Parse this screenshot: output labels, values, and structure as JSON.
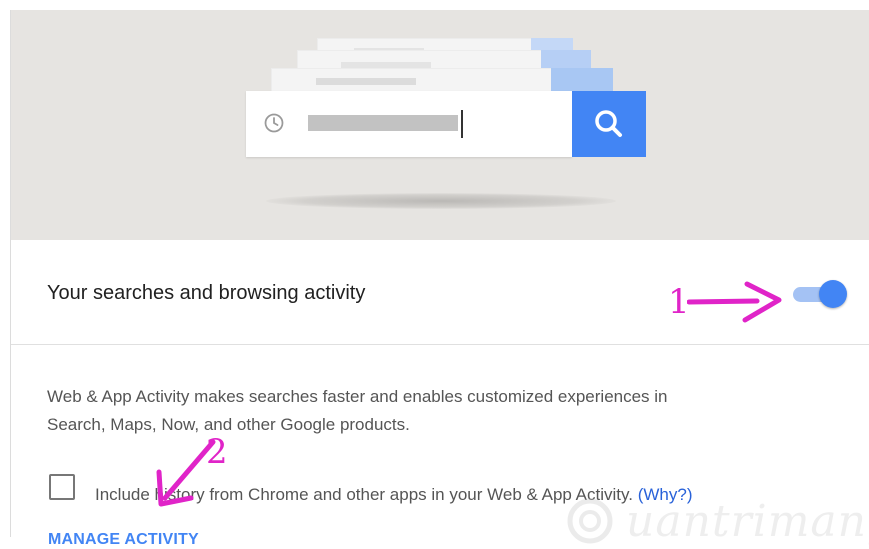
{
  "hero": {
    "illustration": "search-history-cards",
    "search_icon": "search-icon",
    "history_icon": "clock-icon"
  },
  "activity_row": {
    "label": "Your searches and browsing activity",
    "toggle_on": true
  },
  "annotations": {
    "one": "1",
    "two": "2"
  },
  "description": "Web & App Activity makes searches faster and enables customized experiences in Search, Maps, Now, and other Google products.",
  "checkbox": {
    "checked": false,
    "label_text": "Include history from Chrome and other apps in your Web & App Activity. ",
    "why_link": "(Why?)"
  },
  "manage_link": "MANAGE ACTIVITY",
  "watermark": {
    "text": "uantrimang"
  },
  "colors": {
    "accent": "#4285f4",
    "annotation": "#e024c8",
    "hero_bg": "#e6e4e1"
  }
}
